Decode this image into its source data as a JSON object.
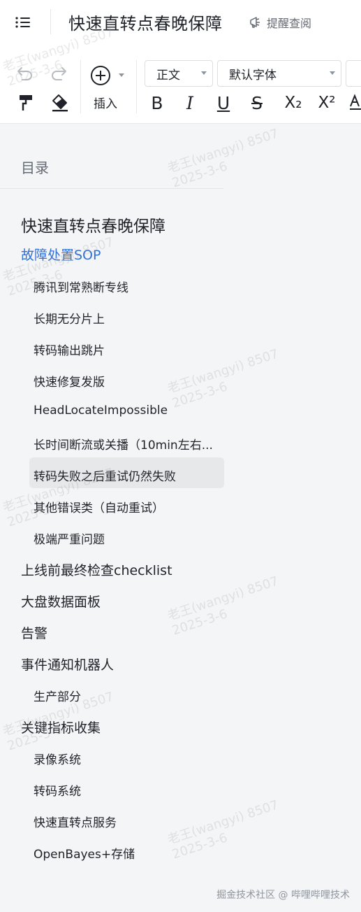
{
  "header": {
    "title": "快速直转点春晚保障",
    "remind_label": "提醒查阅"
  },
  "toolbar": {
    "insert_label": "插入",
    "style_select": "正文",
    "font_select": "默认字体",
    "format_buttons": [
      "B",
      "I",
      "U",
      "S",
      "X₂",
      "X²"
    ]
  },
  "toc": {
    "heading": "目录",
    "items": [
      {
        "label": "快速直转点春晚保障",
        "level": 0
      },
      {
        "label": "故障处置SOP",
        "level": 1,
        "active": true
      },
      {
        "label": "腾讯到常熟断专线",
        "level": 2
      },
      {
        "label": "长期无分片上",
        "level": 2
      },
      {
        "label": "转码输出跳片",
        "level": 2
      },
      {
        "label": "快速修复发版",
        "level": 2
      },
      {
        "label": "HeadLocateImpossible",
        "level": 2
      },
      {
        "label": "长时间断流或关播（10min左右...",
        "level": 2
      },
      {
        "label": "转码失败之后重试仍然失败",
        "level": 2,
        "hovered": true
      },
      {
        "label": "其他错误类（自动重试）",
        "level": 2
      },
      {
        "label": "极端严重问题",
        "level": 2
      },
      {
        "label": "上线前最终检查checklist",
        "level": 1
      },
      {
        "label": "大盘数据面板",
        "level": 1
      },
      {
        "label": "告警",
        "level": 1
      },
      {
        "label": "事件通知机器人",
        "level": 1
      },
      {
        "label": "生产部分",
        "level": 2
      },
      {
        "label": "关键指标收集",
        "level": 1
      },
      {
        "label": "录像系统",
        "level": 2
      },
      {
        "label": "转码系统",
        "level": 2
      },
      {
        "label": "快速直转点服务",
        "level": 2
      },
      {
        "label": "OpenBayes+存储",
        "level": 2
      }
    ]
  },
  "watermark": {
    "line1": "老王(wangyi) 8507",
    "line2": "2025-3-6"
  },
  "footer": "掘金技术社区 @ 哔哩哔哩技术",
  "colors": {
    "accent": "#3370d6",
    "text": "#1f2329",
    "muted": "#646a73",
    "background": "#f4f5f7"
  }
}
